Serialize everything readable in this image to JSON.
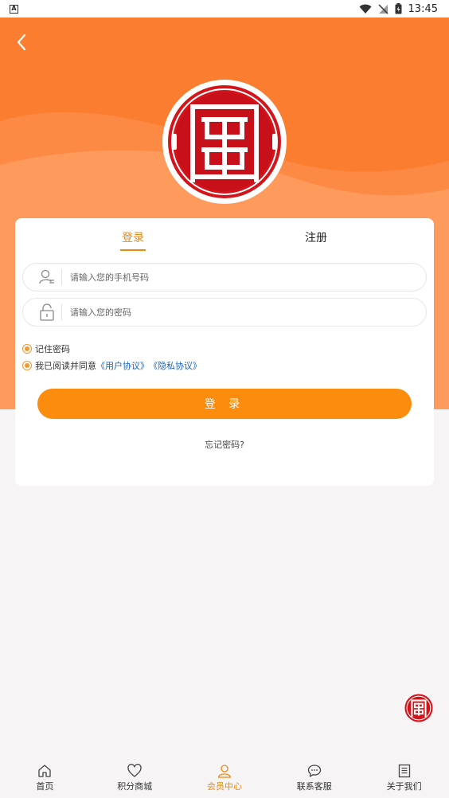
{
  "status_bar": {
    "time": "13:45",
    "left_icon": "A"
  },
  "colors": {
    "accent": "#fb8c0e",
    "hero": "#fb7d30",
    "link": "#1f63b8",
    "logo_red": "#d4141b"
  },
  "auth": {
    "tabs": [
      {
        "label": "登录",
        "active": true
      },
      {
        "label": "注册",
        "active": false
      }
    ],
    "phone": {
      "placeholder": "请输入您的手机号码",
      "value": ""
    },
    "password": {
      "placeholder": "请输入您的密码",
      "value": ""
    },
    "remember_label": "记住密码",
    "agree_prefix": "我已阅读并同意",
    "user_agreement": "《用户协议》",
    "privacy_agreement": "《隐私协议》",
    "submit_label": "登 录",
    "forgot_label": "忘记密码?"
  },
  "tabbar": {
    "items": [
      {
        "label": "首页",
        "icon": "home-icon"
      },
      {
        "label": "积分商城",
        "icon": "heart-icon"
      },
      {
        "label": "会员中心",
        "icon": "user-icon",
        "active": true
      },
      {
        "label": "联系客服",
        "icon": "chat-icon"
      },
      {
        "label": "关于我们",
        "icon": "document-icon"
      }
    ]
  }
}
